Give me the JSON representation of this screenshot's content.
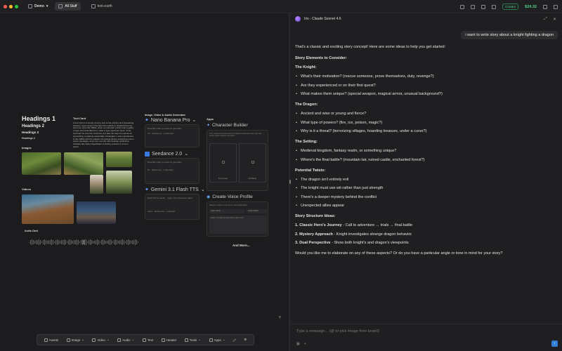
{
  "topbar": {
    "folder": "Demo",
    "tabs": [
      {
        "label": "All Stuff",
        "active": true
      },
      {
        "label": "test-earth",
        "active": false
      }
    ],
    "plan_badge": "Creator",
    "balance": "$24.32"
  },
  "canvas": {
    "headings": [
      "Headings 1",
      "Headings 2",
      "Headings 3",
      "Headings 4"
    ],
    "images_label": "Images",
    "videos_label": "Videos",
    "text_card_title": "Text Card",
    "text_card_body": "Lorem ipsum is simply dummy text of the printing and typesetting industry. Lorem Ipsum has been the industry's standard dummy text ever since the 1500s, when an unknown printer took a galley of type and scrambled it to make a type specimen book. It has survived not only five centuries, but also the leap into electronic typesetting, remaining essentially unchanged. It was popularised in the 1960s with the release of Letraset sheets containing Lorem Ipsum passages, and more recently with desktop publishing software like Aldus PageMaker including versions of Lorem Ipsum.",
    "audio_card_label": "Audio Card",
    "generator_label": "Image, Video & Audio Generator",
    "generators": [
      {
        "name": "Nano Banana Pro",
        "prompt": "Describe what you want to generate...",
        "meta": "1K · Reference · 4 attempts",
        "ratio": "1:1"
      },
      {
        "name": "Seedance 2.0",
        "prompt": "Describe what you want to generate...",
        "meta": "5s · Reference · 4 attempts",
        "ratio": "16:9"
      },
      {
        "name": "Gemini 3.1 Flash TTS",
        "prompt": "Enter text to speak... (type / for expressive tags)",
        "meta": "Voice · Reference · 1 attempt",
        "ratio": ""
      }
    ],
    "apps_label": "Apps",
    "apps": [
      {
        "name": "Character Builder",
        "desc": "Turn a reference photo into a consistent character sheet you can reuse across scenes and shots."
      },
      {
        "name": "Create Voice Profile",
        "desc": "Design a custom voice from a short description"
      }
    ],
    "char_builder_slots": [
      "Front view",
      "Full Body"
    ],
    "voice_fields": [
      "Voice Name",
      "Audio Stable"
    ],
    "voice_hint": "Warm, friendly narrator with a clear tone",
    "and_more": "And More..."
  },
  "toolbar": {
    "items": [
      "Assets",
      "Image",
      "Video",
      "Audio",
      "Text",
      "Header",
      "Tools",
      "Apps"
    ]
  },
  "chat": {
    "title": "Iris - Claude Sonnet 4.6",
    "user_message": "i want to write story about a knight fighting a dragon",
    "intro": "That's a classic and exciting story concept! Here are some ideas to help you get started:",
    "story_elements": "Story Elements to Consider:",
    "knight_head": "The Knight:",
    "knight": [
      "What's their motivation? (rescue someone, prove themselves, duty, revenge?)",
      "Are they experienced or on their first quest?",
      "What makes them unique? (special weapon, magical armor, unusual background?)"
    ],
    "dragon_head": "The Dragon:",
    "dragon": [
      "Ancient and wise or young and fierce?",
      "What type of powers? (fire, ice, poison, magic?)",
      "Why is it a threat? (terrorizing villages, hoarding treasure, under a curse?)"
    ],
    "setting_head": "The Setting:",
    "setting": [
      "Medieval kingdom, fantasy realm, or something unique?",
      "Where's the final battle? (mountain lair, ruined castle, enchanted forest?)"
    ],
    "twists_head": "Potential Twists:",
    "twists": [
      "The dragon isn't entirely evil",
      "The knight must use wit rather than just strength",
      "There's a deeper mystery behind the conflict",
      "Unexpected allies appear"
    ],
    "structure_head": "Story Structure Ideas:",
    "structure": [
      {
        "label": "1. Classic Hero's Journey",
        "text": " - Call to adventure → trials → final battle"
      },
      {
        "label": "2. Mystery Approach",
        "text": " - Knight investigates strange dragon behavior"
      },
      {
        "label": "3. Dual Perspective",
        "text": " - Show both knight's and dragon's viewpoints"
      }
    ],
    "closing": "Would you like me to elaborate on any of these aspects? Or do you have a particular angle or tone in mind for your story?",
    "input_placeholder": "Type a message... (@ to pick image from board)"
  }
}
